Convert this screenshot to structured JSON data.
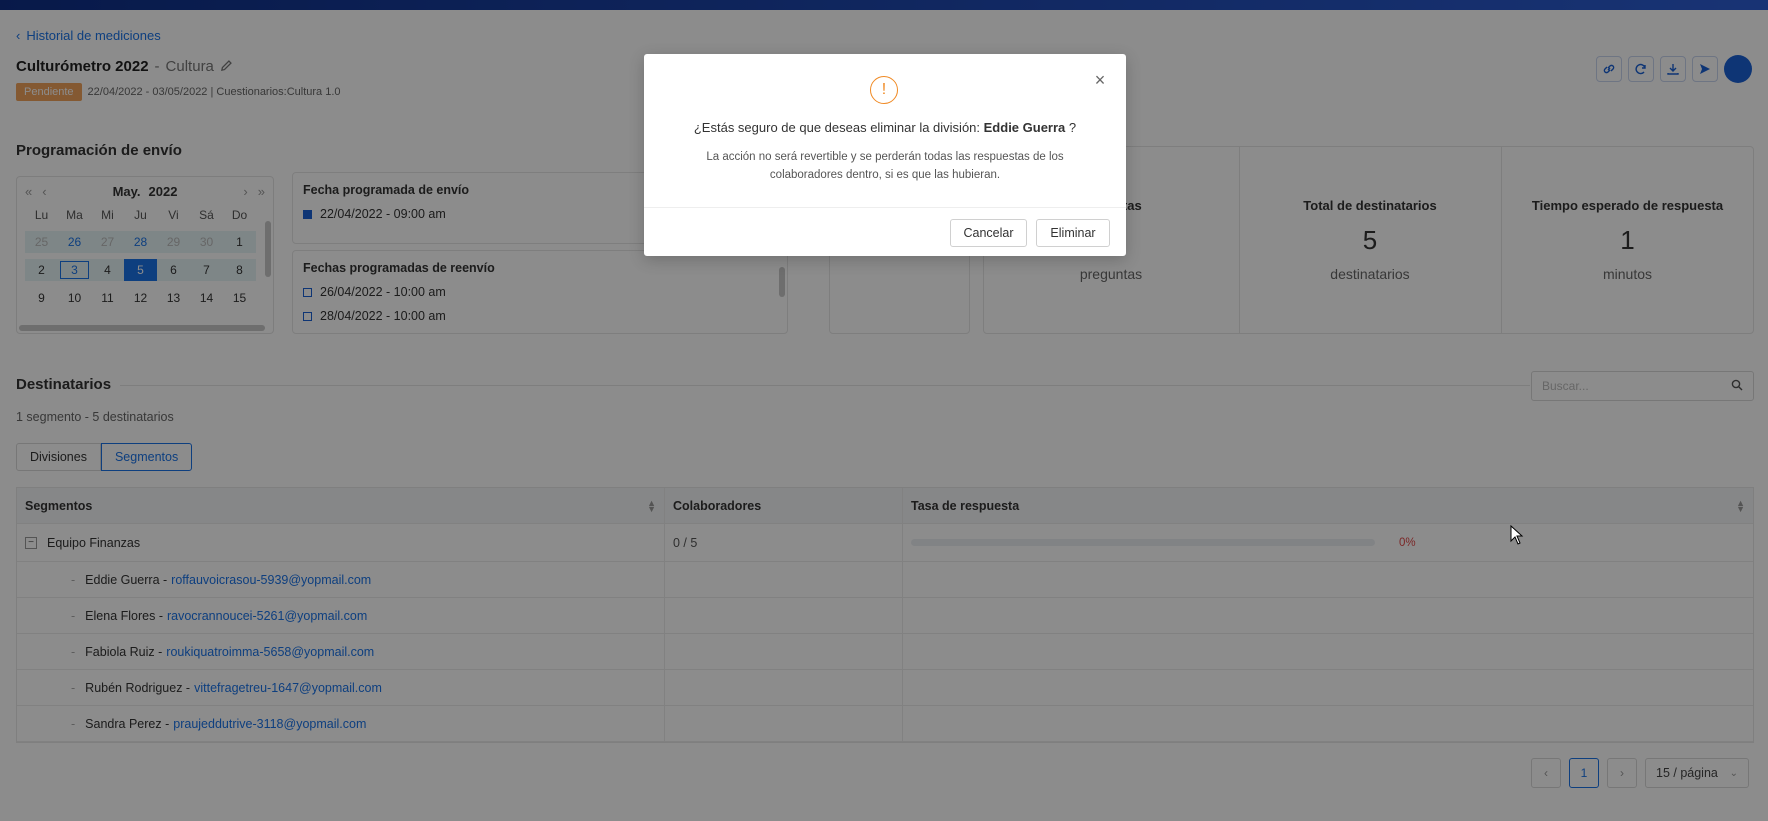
{
  "header": {
    "back_label": "Historial de mediciones",
    "title": "Culturómetro 2022",
    "title_sep": "-",
    "subtitle": "Cultura",
    "status_badge": "Pendiente",
    "meta": "22/04/2022 - 03/05/2022 | Cuestionarios:Cultura 1.0"
  },
  "toolbar": {
    "icons": [
      "link-icon",
      "refresh-icon",
      "download-icon",
      "send-icon",
      "avatar"
    ]
  },
  "schedule": {
    "section_title": "Programación de envío",
    "calendar": {
      "month": "May.",
      "year": "2022",
      "weekdays": [
        "Lu",
        "Ma",
        "Mi",
        "Ju",
        "Vi",
        "Sá",
        "Do"
      ],
      "rows": [
        [
          "25",
          "26",
          "27",
          "28",
          "29",
          "30",
          "1"
        ],
        [
          "2",
          "3",
          "4",
          "5",
          "6",
          "7",
          "8"
        ],
        [
          "9",
          "10",
          "11",
          "12",
          "13",
          "14",
          "15"
        ]
      ],
      "selected_day": "5",
      "today_day": "3"
    },
    "send_label": "Fecha programada de envío",
    "send_date": "22/04/2022 - 09:00 am",
    "resend_label": "Fechas programadas de reenvío",
    "resend_dates": [
      "26/04/2022 - 10:00 am",
      "28/04/2022 - 10:00 am"
    ]
  },
  "stats": {
    "questions_label_partial": "untas",
    "questions_unit": "preguntas",
    "recipients_label": "Total de destinatarios",
    "recipients_value": "5",
    "recipients_unit": "destinatarios",
    "time_label": "Tiempo esperado de respuesta",
    "time_value": "1",
    "time_unit": "minutos"
  },
  "recipients": {
    "section_title": "Destinatarios",
    "search_placeholder": "Buscar...",
    "count_text": "1 segmento - 5 destinatarios",
    "tabs": [
      "Divisiones",
      "Segmentos"
    ],
    "active_tab": "Segmentos",
    "columns": [
      "Segmentos",
      "Colaboradores",
      "Tasa de respuesta"
    ],
    "group": {
      "name": "Equipo Finanzas",
      "collaborators": "0 / 5",
      "rate_label": "0%",
      "rate_fraction": 0
    },
    "people": [
      {
        "name": "Eddie Guerra -",
        "email": "roffauvoicrasou-5939@yopmail.com"
      },
      {
        "name": "Elena Flores -",
        "email": "ravocrannoucei-5261@yopmail.com"
      },
      {
        "name": "Fabiola Ruiz -",
        "email": "roukiquatroimma-5658@yopmail.com"
      },
      {
        "name": "Rubén Rodriguez -",
        "email": "vittefragetreu-1647@yopmail.com"
      },
      {
        "name": "Sandra Perez -",
        "email": "praujeddutrive-3118@yopmail.com"
      }
    ]
  },
  "pagination": {
    "current_page": "1",
    "page_size": "15 / página"
  },
  "modal": {
    "question_prefix": "¿Estás seguro de que deseas eliminar la división:",
    "target": "Eddie Guerra",
    "question_suffix": "?",
    "description": "La acción no será revertible y se perderán todas las respuestas de los colaboradores dentro, si es que las hubieran.",
    "cancel_label": "Cancelar",
    "delete_label": "Eliminar"
  },
  "colors": {
    "accent": "#1a73e8",
    "badge": "#f0a35b",
    "warning": "#f08a24",
    "rate": "#e04848"
  }
}
